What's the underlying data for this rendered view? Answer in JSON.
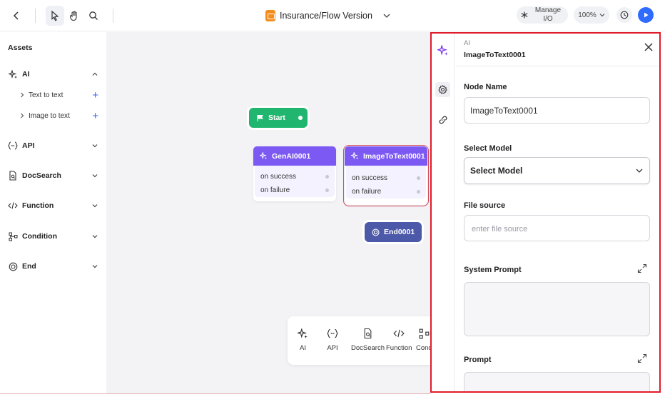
{
  "topbar": {
    "title": "Insurance/Flow Version",
    "manage_label_line1": "Manage",
    "manage_label_line2": "I/O",
    "zoom": "100%"
  },
  "sidebar": {
    "heading": "Assets",
    "categories": [
      {
        "label": "AI",
        "icon": "sparkle-icon",
        "expanded": true,
        "children": [
          {
            "label": "Text to text"
          },
          {
            "label": "Image to text"
          }
        ]
      },
      {
        "label": "API",
        "icon": "braces-icon",
        "expanded": false
      },
      {
        "label": "DocSearch",
        "icon": "doc-search-icon",
        "expanded": false
      },
      {
        "label": "Function",
        "icon": "code-icon",
        "expanded": false
      },
      {
        "label": "Condition",
        "icon": "branch-icon",
        "expanded": false
      },
      {
        "label": "End",
        "icon": "end-icon",
        "expanded": false
      }
    ]
  },
  "canvas": {
    "start": "Start",
    "genai": {
      "title": "GenAI0001",
      "success": "on success",
      "failure": "on failure"
    },
    "img2txt": {
      "title": "ImageToText0001",
      "success": "on success",
      "failure": "on failure"
    },
    "end": "End0001",
    "palette": [
      "AI",
      "API",
      "DocSearch",
      "Function",
      "Cond"
    ]
  },
  "panel": {
    "subtitle": "AI",
    "title": "ImageToText0001",
    "node_name_label": "Node Name",
    "node_name_value": "ImageToText0001",
    "select_model_label": "Select Model",
    "select_model_value": "Select Model",
    "file_source_label": "File source",
    "file_source_placeholder": "enter file source",
    "system_prompt_label": "System Prompt",
    "prompt_label": "Prompt"
  },
  "colors": {
    "accent": "#2f6bff",
    "ai_node": "#7c59f2",
    "start_node": "#21b66f",
    "end_node": "#4c58a8",
    "panel_border": "#e01b2a"
  }
}
